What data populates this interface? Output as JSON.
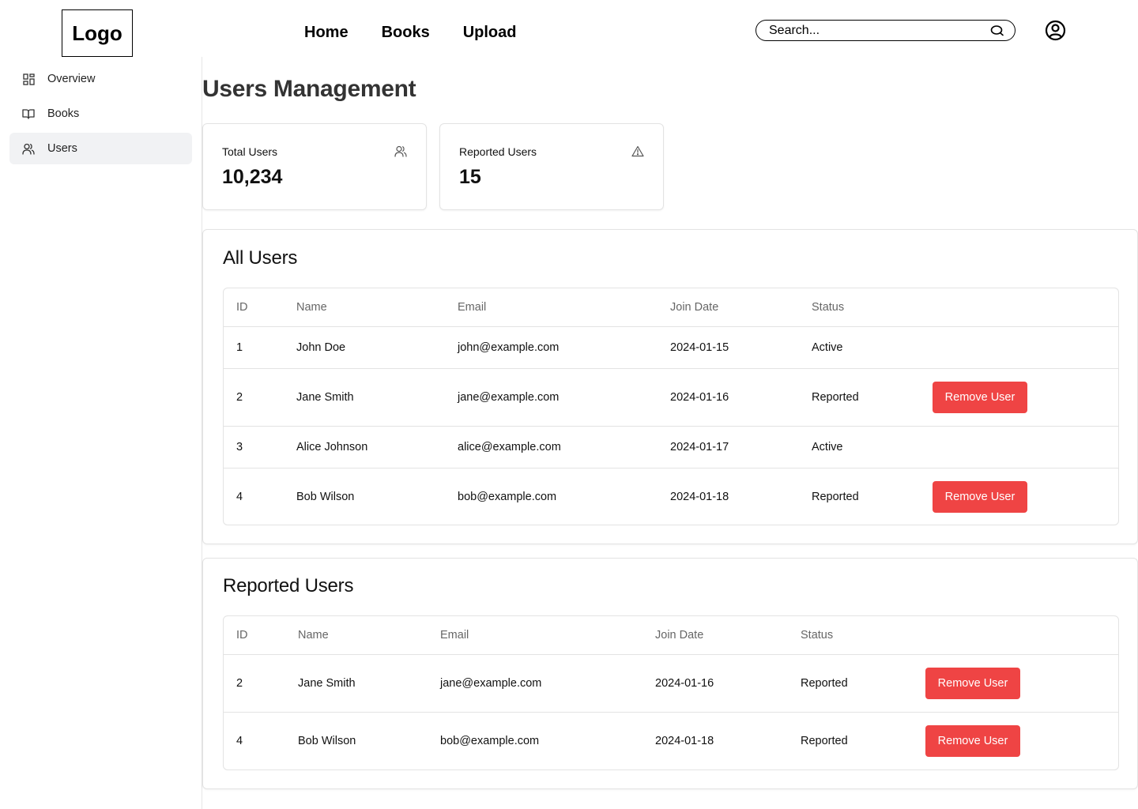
{
  "header": {
    "logo": "Logo",
    "nav": [
      "Home",
      "Books",
      "Upload"
    ],
    "search_placeholder": "Search...",
    "search_icon": "search-icon",
    "profile_icon": "user-circle-icon"
  },
  "sidebar": {
    "items": [
      {
        "label": "Overview",
        "icon": "dashboard-grid-icon",
        "active": false
      },
      {
        "label": "Books",
        "icon": "open-book-icon",
        "active": false
      },
      {
        "label": "Users",
        "icon": "users-icon",
        "active": true
      }
    ]
  },
  "main": {
    "title": "Users Management",
    "stats": [
      {
        "label": "Total Users",
        "value": "10,234",
        "icon": "users-icon"
      },
      {
        "label": "Reported Users",
        "value": "15",
        "icon": "warning-triangle-icon"
      }
    ],
    "all_users": {
      "title": "All Users",
      "columns": [
        "ID",
        "Name",
        "Email",
        "Join Date",
        "Status"
      ],
      "rows": [
        {
          "id": "1",
          "name": "John Doe",
          "email": "john@example.com",
          "join_date": "2024-01-15",
          "status": "Active",
          "action": ""
        },
        {
          "id": "2",
          "name": "Jane Smith",
          "email": "jane@example.com",
          "join_date": "2024-01-16",
          "status": "Reported",
          "action": "Remove User"
        },
        {
          "id": "3",
          "name": "Alice Johnson",
          "email": "alice@example.com",
          "join_date": "2024-01-17",
          "status": "Active",
          "action": ""
        },
        {
          "id": "4",
          "name": "Bob Wilson",
          "email": "bob@example.com",
          "join_date": "2024-01-18",
          "status": "Reported",
          "action": "Remove User"
        }
      ]
    },
    "reported_users": {
      "title": "Reported Users",
      "columns": [
        "ID",
        "Name",
        "Email",
        "Join Date",
        "Status"
      ],
      "rows": [
        {
          "id": "2",
          "name": "Jane Smith",
          "email": "jane@example.com",
          "join_date": "2024-01-16",
          "status": "Reported",
          "action": "Remove User"
        },
        {
          "id": "4",
          "name": "Bob Wilson",
          "email": "bob@example.com",
          "join_date": "2024-01-18",
          "status": "Reported",
          "action": "Remove User"
        }
      ]
    }
  },
  "colors": {
    "danger": "#ef4444",
    "active_nav_bg": "#f1f2f4",
    "border": "#e3e3e3",
    "muted_text": "#666666"
  }
}
